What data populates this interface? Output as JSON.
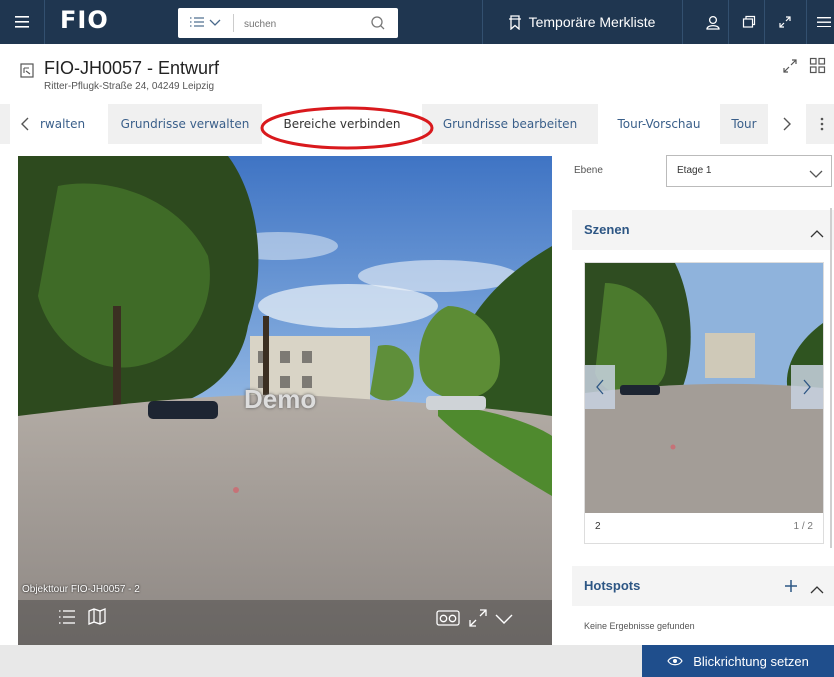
{
  "topbar": {
    "logo": "FIO",
    "search_placeholder": "suchen",
    "merkliste_label": "Temporäre Merkliste",
    "icons": [
      "menu-icon",
      "list-icon",
      "chevron-down-icon",
      "search-icon",
      "bookmark-icon",
      "user-icon",
      "window-icon",
      "expand-icon",
      "hamburger-icon"
    ]
  },
  "header": {
    "title": "FIO-JH0057 - Entwurf",
    "address": "Ritter-Pflugk-Straße 24, 04249 Leipzig"
  },
  "tabs": [
    {
      "label": "rwalten",
      "active": false
    },
    {
      "label": "Grundrisse verwalten",
      "active": false
    },
    {
      "label": "Bereiche verbinden",
      "active": true
    },
    {
      "label": "Grundrisse bearbeiten",
      "active": false
    },
    {
      "label": "Tour-Vorschau",
      "active": false
    },
    {
      "label": "Tour",
      "active": false
    }
  ],
  "panorama": {
    "watermark": "Demo",
    "caption": "Objekttour FIO-JH0057 - 2"
  },
  "right_panel": {
    "ebene_label": "Ebene",
    "ebene_value": "Etage 1",
    "szenen_title": "Szenen",
    "scene_number": "2",
    "scene_pager": "1 / 2",
    "hotspots_title": "Hotspots",
    "hotspots_empty": "Keine Ergebnisse gefunden"
  },
  "footer": {
    "action_label": "Blickrichtung setzen"
  },
  "colors": {
    "topbar": "#1f3650",
    "accent": "#2d5684",
    "action_button": "#1f4e8c",
    "highlight_ring": "#d9191d"
  }
}
